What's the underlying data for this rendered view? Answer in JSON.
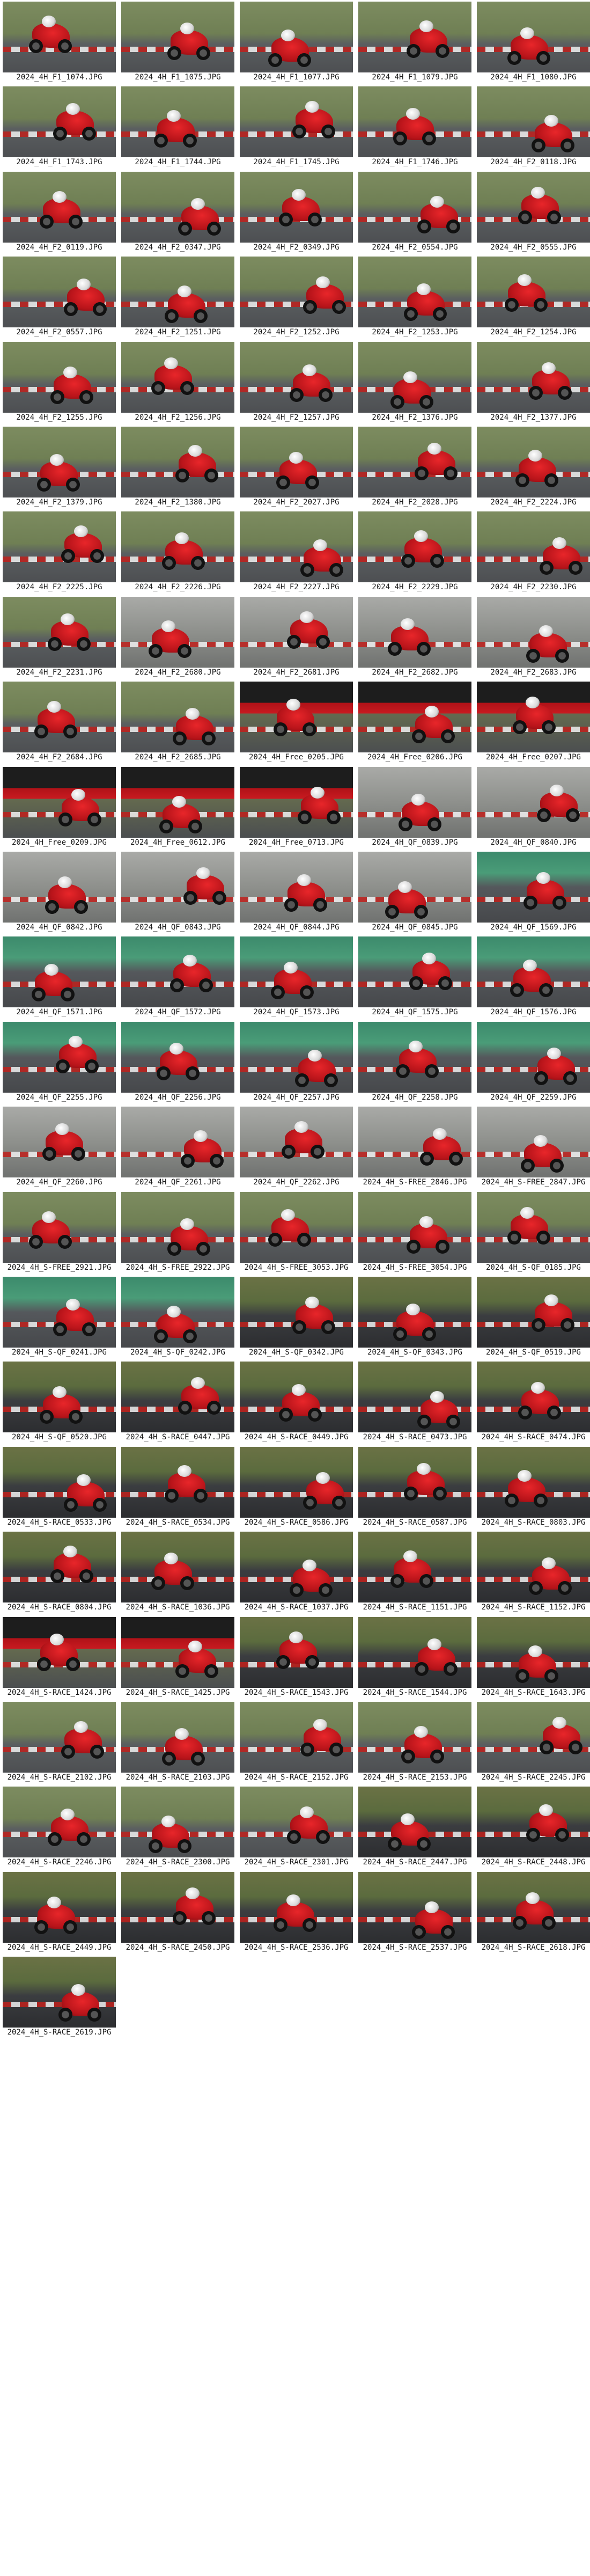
{
  "gallery": {
    "items": [
      {
        "caption": "2024_4H_F1_1074.JPG",
        "style": "std"
      },
      {
        "caption": "2024_4H_F1_1075.JPG",
        "style": "std"
      },
      {
        "caption": "2024_4H_F1_1077.JPG",
        "style": "std"
      },
      {
        "caption": "2024_4H_F1_1079.JPG",
        "style": "std"
      },
      {
        "caption": "2024_4H_F1_1080.JPG",
        "style": "std"
      },
      {
        "caption": "2024_4H_F1_1743.JPG",
        "style": "std"
      },
      {
        "caption": "2024_4H_F1_1744.JPG",
        "style": "std"
      },
      {
        "caption": "2024_4H_F1_1745.JPG",
        "style": "std"
      },
      {
        "caption": "2024_4H_F1_1746.JPG",
        "style": "std"
      },
      {
        "caption": "2024_4H_F2_0118.JPG",
        "style": "std"
      },
      {
        "caption": "2024_4H_F2_0119.JPG",
        "style": "std"
      },
      {
        "caption": "2024_4H_F2_0347.JPG",
        "style": "std"
      },
      {
        "caption": "2024_4H_F2_0349.JPG",
        "style": "std"
      },
      {
        "caption": "2024_4H_F2_0554.JPG",
        "style": "std"
      },
      {
        "caption": "2024_4H_F2_0555.JPG",
        "style": "std"
      },
      {
        "caption": "2024_4H_F2_0557.JPG",
        "style": "std"
      },
      {
        "caption": "2024_4H_F2_1251.JPG",
        "style": "std"
      },
      {
        "caption": "2024_4H_F2_1252.JPG",
        "style": "std"
      },
      {
        "caption": "2024_4H_F2_1253.JPG",
        "style": "std"
      },
      {
        "caption": "2024_4H_F2_1254.JPG",
        "style": "std"
      },
      {
        "caption": "2024_4H_F2_1255.JPG",
        "style": "std"
      },
      {
        "caption": "2024_4H_F2_1256.JPG",
        "style": "std"
      },
      {
        "caption": "2024_4H_F2_1257.JPG",
        "style": "std"
      },
      {
        "caption": "2024_4H_F2_1376.JPG",
        "style": "std"
      },
      {
        "caption": "2024_4H_F2_1377.JPG",
        "style": "std"
      },
      {
        "caption": "2024_4H_F2_1379.JPG",
        "style": "std"
      },
      {
        "caption": "2024_4H_F2_1380.JPG",
        "style": "std"
      },
      {
        "caption": "2024_4H_F2_2027.JPG",
        "style": "std"
      },
      {
        "caption": "2024_4H_F2_2028.JPG",
        "style": "std"
      },
      {
        "caption": "2024_4H_F2_2224.JPG",
        "style": "std"
      },
      {
        "caption": "2024_4H_F2_2225.JPG",
        "style": "std"
      },
      {
        "caption": "2024_4H_F2_2226.JPG",
        "style": "std"
      },
      {
        "caption": "2024_4H_F2_2227.JPG",
        "style": "std"
      },
      {
        "caption": "2024_4H_F2_2229.JPG",
        "style": "std"
      },
      {
        "caption": "2024_4H_F2_2230.JPG",
        "style": "std"
      },
      {
        "caption": "2024_4H_F2_2231.JPG",
        "style": "std"
      },
      {
        "caption": "2024_4H_F2_2680.JPG",
        "style": "pit"
      },
      {
        "caption": "2024_4H_F2_2681.JPG",
        "style": "pit"
      },
      {
        "caption": "2024_4H_F2_2682.JPG",
        "style": "pit"
      },
      {
        "caption": "2024_4H_F2_2683.JPG",
        "style": "pit"
      },
      {
        "caption": "2024_4H_F2_2684.JPG",
        "style": "std"
      },
      {
        "caption": "2024_4H_F2_2685.JPG",
        "style": "std"
      },
      {
        "caption": "2024_4H_Free_0205.JPG",
        "style": "banner"
      },
      {
        "caption": "2024_4H_Free_0206.JPG",
        "style": "banner"
      },
      {
        "caption": "2024_4H_Free_0207.JPG",
        "style": "banner"
      },
      {
        "caption": "2024_4H_Free_0209.JPG",
        "style": "banner"
      },
      {
        "caption": "2024_4H_Free_0612.JPG",
        "style": "banner"
      },
      {
        "caption": "2024_4H_Free_0713.JPG",
        "style": "banner"
      },
      {
        "caption": "2024_4H_QF_0839.JPG",
        "style": "pit"
      },
      {
        "caption": "2024_4H_QF_0840.JPG",
        "style": "pit"
      },
      {
        "caption": "2024_4H_QF_0842.JPG",
        "style": "pit"
      },
      {
        "caption": "2024_4H_QF_0843.JPG",
        "style": "pit"
      },
      {
        "caption": "2024_4H_QF_0844.JPG",
        "style": "pit"
      },
      {
        "caption": "2024_4H_QF_0845.JPG",
        "style": "pit"
      },
      {
        "caption": "2024_4H_QF_1569.JPG",
        "style": "green"
      },
      {
        "caption": "2024_4H_QF_1571.JPG",
        "style": "green"
      },
      {
        "caption": "2024_4H_QF_1572.JPG",
        "style": "green"
      },
      {
        "caption": "2024_4H_QF_1573.JPG",
        "style": "green"
      },
      {
        "caption": "2024_4H_QF_1575.JPG",
        "style": "green"
      },
      {
        "caption": "2024_4H_QF_1576.JPG",
        "style": "green"
      },
      {
        "caption": "2024_4H_QF_2255.JPG",
        "style": "green"
      },
      {
        "caption": "2024_4H_QF_2256.JPG",
        "style": "green"
      },
      {
        "caption": "2024_4H_QF_2257.JPG",
        "style": "green"
      },
      {
        "caption": "2024_4H_QF_2258.JPG",
        "style": "green"
      },
      {
        "caption": "2024_4H_QF_2259.JPG",
        "style": "green"
      },
      {
        "caption": "2024_4H_QF_2260.JPG",
        "style": "pit"
      },
      {
        "caption": "2024_4H_QF_2261.JPG",
        "style": "pit"
      },
      {
        "caption": "2024_4H_QF_2262.JPG",
        "style": "pit"
      },
      {
        "caption": "2024_4H_S-FREE_2846.JPG",
        "style": "pit"
      },
      {
        "caption": "2024_4H_S-FREE_2847.JPG",
        "style": "pit"
      },
      {
        "caption": "2024_4H_S-FREE_2921.JPG",
        "style": "std"
      },
      {
        "caption": "2024_4H_S-FREE_2922.JPG",
        "style": "std"
      },
      {
        "caption": "2024_4H_S-FREE_3053.JPG",
        "style": "std"
      },
      {
        "caption": "2024_4H_S-FREE_3054.JPG",
        "style": "std"
      },
      {
        "caption": "2024_4H_S-QF_0185.JPG",
        "style": "std"
      },
      {
        "caption": "2024_4H_S-QF_0241.JPG",
        "style": "green"
      },
      {
        "caption": "2024_4H_S-QF_0242.JPG",
        "style": "green"
      },
      {
        "caption": "2024_4H_S-QF_0342.JPG",
        "style": "dark"
      },
      {
        "caption": "2024_4H_S-QF_0343.JPG",
        "style": "dark"
      },
      {
        "caption": "2024_4H_S-QF_0519.JPG",
        "style": "dark"
      },
      {
        "caption": "2024_4H_S-QF_0520.JPG",
        "style": "dark"
      },
      {
        "caption": "2024_4H_S-RACE_0447.JPG",
        "style": "dark"
      },
      {
        "caption": "2024_4H_S-RACE_0449.JPG",
        "style": "dark"
      },
      {
        "caption": "2024_4H_S-RACE_0473.JPG",
        "style": "dark"
      },
      {
        "caption": "2024_4H_S-RACE_0474.JPG",
        "style": "dark"
      },
      {
        "caption": "2024_4H_S-RACE_0533.JPG",
        "style": "dark"
      },
      {
        "caption": "2024_4H_S-RACE_0534.JPG",
        "style": "dark"
      },
      {
        "caption": "2024_4H_S-RACE_0586.JPG",
        "style": "dark"
      },
      {
        "caption": "2024_4H_S-RACE_0587.JPG",
        "style": "dark"
      },
      {
        "caption": "2024_4H_S-RACE_0803.JPG",
        "style": "dark"
      },
      {
        "caption": "2024_4H_S-RACE_0804.JPG",
        "style": "dark"
      },
      {
        "caption": "2024_4H_S-RACE_1036.JPG",
        "style": "dark"
      },
      {
        "caption": "2024_4H_S-RACE_1037.JPG",
        "style": "dark"
      },
      {
        "caption": "2024_4H_S-RACE_1151.JPG",
        "style": "dark"
      },
      {
        "caption": "2024_4H_S-RACE_1152.JPG",
        "style": "dark"
      },
      {
        "caption": "2024_4H_S-RACE_1424.JPG",
        "style": "banner"
      },
      {
        "caption": "2024_4H_S-RACE_1425.JPG",
        "style": "banner"
      },
      {
        "caption": "2024_4H_S-RACE_1543.JPG",
        "style": "dark"
      },
      {
        "caption": "2024_4H_S-RACE_1544.JPG",
        "style": "dark"
      },
      {
        "caption": "2024_4H_S-RACE_1643.JPG",
        "style": "dark"
      },
      {
        "caption": "2024_4H_S-RACE_2102.JPG",
        "style": "std"
      },
      {
        "caption": "2024_4H_S-RACE_2103.JPG",
        "style": "std"
      },
      {
        "caption": "2024_4H_S-RACE_2152.JPG",
        "style": "std"
      },
      {
        "caption": "2024_4H_S-RACE_2153.JPG",
        "style": "std"
      },
      {
        "caption": "2024_4H_S-RACE_2245.JPG",
        "style": "std"
      },
      {
        "caption": "2024_4H_S-RACE_2246.JPG",
        "style": "std"
      },
      {
        "caption": "2024_4H_S-RACE_2300.JPG",
        "style": "std"
      },
      {
        "caption": "2024_4H_S-RACE_2301.JPG",
        "style": "std"
      },
      {
        "caption": "2024_4H_S-RACE_2447.JPG",
        "style": "dark"
      },
      {
        "caption": "2024_4H_S-RACE_2448.JPG",
        "style": "dark"
      },
      {
        "caption": "2024_4H_S-RACE_2449.JPG",
        "style": "dark"
      },
      {
        "caption": "2024_4H_S-RACE_2450.JPG",
        "style": "dark"
      },
      {
        "caption": "2024_4H_S-RACE_2536.JPG",
        "style": "dark"
      },
      {
        "caption": "2024_4H_S-RACE_2537.JPG",
        "style": "dark"
      },
      {
        "caption": "2024_4H_S-RACE_2618.JPG",
        "style": "dark"
      },
      {
        "caption": "2024_4H_S-RACE_2619.JPG",
        "style": "dark"
      }
    ]
  }
}
